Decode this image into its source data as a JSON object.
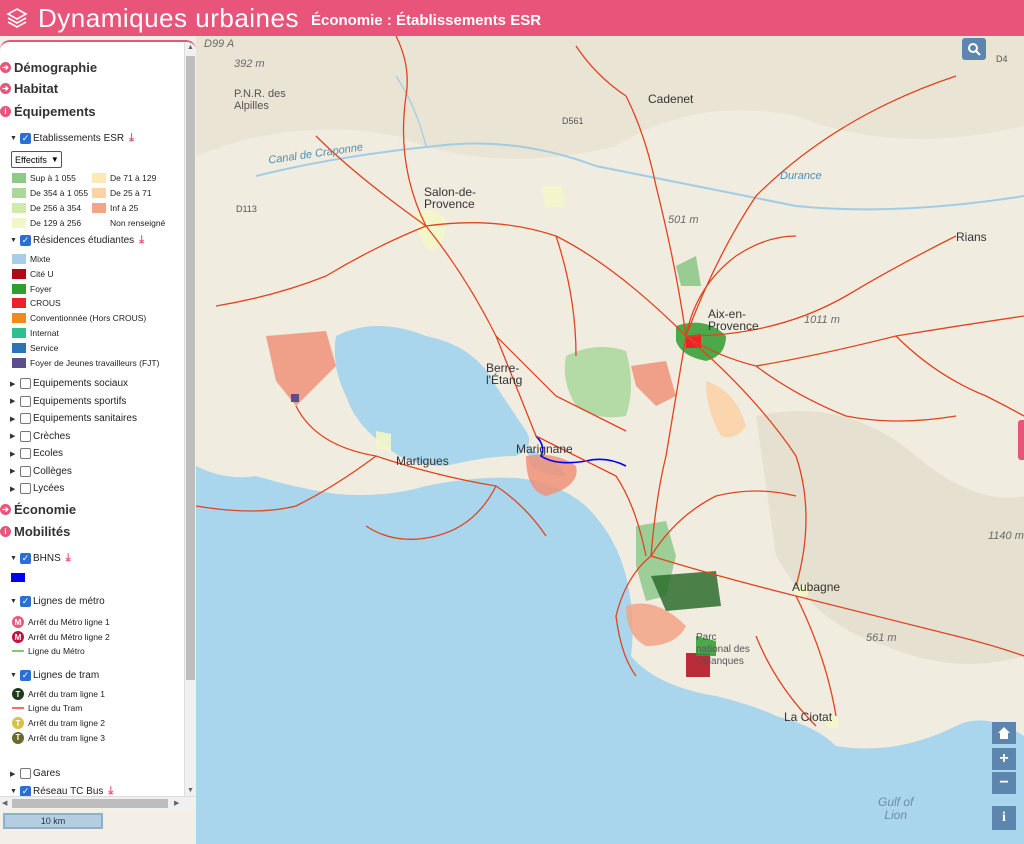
{
  "header": {
    "title": "Dynamiques urbaines",
    "subtitle": "Économie : Établissements ESR",
    "logo_icon": "layers-icon",
    "color": "#e8547a"
  },
  "sidebar": {
    "sections": {
      "demographie": "Démographie",
      "habitat": "Habitat",
      "equipements": "Équipements",
      "economie": "Économie",
      "mobilites": "Mobilités"
    },
    "esr": {
      "label": "Etablissements ESR",
      "select_value": "Effectifs",
      "legend": [
        {
          "label": "Sup à 1 055",
          "color": "#8ec98a"
        },
        {
          "label": "De 71 à 129",
          "color": "#fde9b6"
        },
        {
          "label": "De 354 à 1 055",
          "color": "#a9d89a"
        },
        {
          "label": "De 25 à 71",
          "color": "#fbd3a8"
        },
        {
          "label": "De 256 à 354",
          "color": "#cfeaa9"
        },
        {
          "label": "Inf à 25",
          "color": "#f2a585"
        },
        {
          "label": "De 129 à 256",
          "color": "#f3f7c8"
        },
        {
          "label": "Non renseigné",
          "color": "#ffffff"
        }
      ]
    },
    "residences": {
      "label": "Résidences étudiantes",
      "legend": [
        {
          "label": "Mixte",
          "color": "#a8cde8"
        },
        {
          "label": "Cité U",
          "color": "#b00a1a"
        },
        {
          "label": "Foyer",
          "color": "#2e9e2e"
        },
        {
          "label": "CROUS",
          "color": "#e8232a"
        },
        {
          "label": "Conventionnée (Hors CROUS)",
          "color": "#f08a1c"
        },
        {
          "label": "Internat",
          "color": "#2ebf8f"
        },
        {
          "label": "Service",
          "color": "#2a74b8"
        },
        {
          "label": "Foyer de Jeunes travailleurs (FJT)",
          "color": "#5a4f8a"
        }
      ]
    },
    "equip_layers": [
      "Equipements sociaux",
      "Equipements sportifs",
      "Equipements sanitaires",
      "Crèches",
      "Ecoles",
      "Collèges",
      "Lycées"
    ],
    "bhns": {
      "label": "BHNS",
      "color": "#0000ee"
    },
    "metro": {
      "label": "Lignes de métro",
      "legend": [
        {
          "label": "Arrêt du Métro ligne 1",
          "symbol": "M",
          "color": "#e65c7a"
        },
        {
          "label": "Arrêt du Métro ligne 2",
          "symbol": "M",
          "color": "#c0143c"
        },
        {
          "label": "Ligne du Métro",
          "color": "#88c870"
        }
      ]
    },
    "tram": {
      "label": "Lignes de tram",
      "legend": [
        {
          "label": "Arrêt du tram ligne 1",
          "symbol": "T",
          "color": "#1c3a1c"
        },
        {
          "label": "Ligne du Tram",
          "color": "#ff6a6a"
        },
        {
          "label": "Arrêt du tram ligne 2",
          "symbol": "T",
          "color": "#d8c04a"
        },
        {
          "label": "Arrêt du tram ligne 3",
          "symbol": "T",
          "color": "#6a6a2a"
        }
      ]
    },
    "gares": "Gares",
    "reseau": "Réseau TC Bus"
  },
  "map": {
    "labels": {
      "d99a": "D99 A",
      "m392": "392 m",
      "pnr": "P.N.R. des\nAlpilles",
      "cadenet": "Cadenet",
      "canal": "Canal de Craponne",
      "durance": "Durance",
      "d113": "D113",
      "salon": "Salon-de-\nProvence",
      "m501": "501 m",
      "rians": "Rians",
      "aix": "Aix-en-\nProvence",
      "m1011": "1011 m",
      "berre": "Berre-\nl'Étang",
      "martigues": "Martigues",
      "marignane": "Marignane",
      "m1140": "1140 m",
      "aubagne": "Aubagne",
      "m561": "561 m",
      "calanques": "Parc\nnational des\nCalanques",
      "laciotat": "La Ciotat",
      "gulf": "Gulf of\nLion",
      "d561": "D561",
      "d4": "D4"
    }
  },
  "controls": {
    "search_icon": "search-icon",
    "home_icon": "home-icon",
    "zoom_in": "+",
    "zoom_out": "−",
    "info": "i",
    "scale": "10 km"
  }
}
